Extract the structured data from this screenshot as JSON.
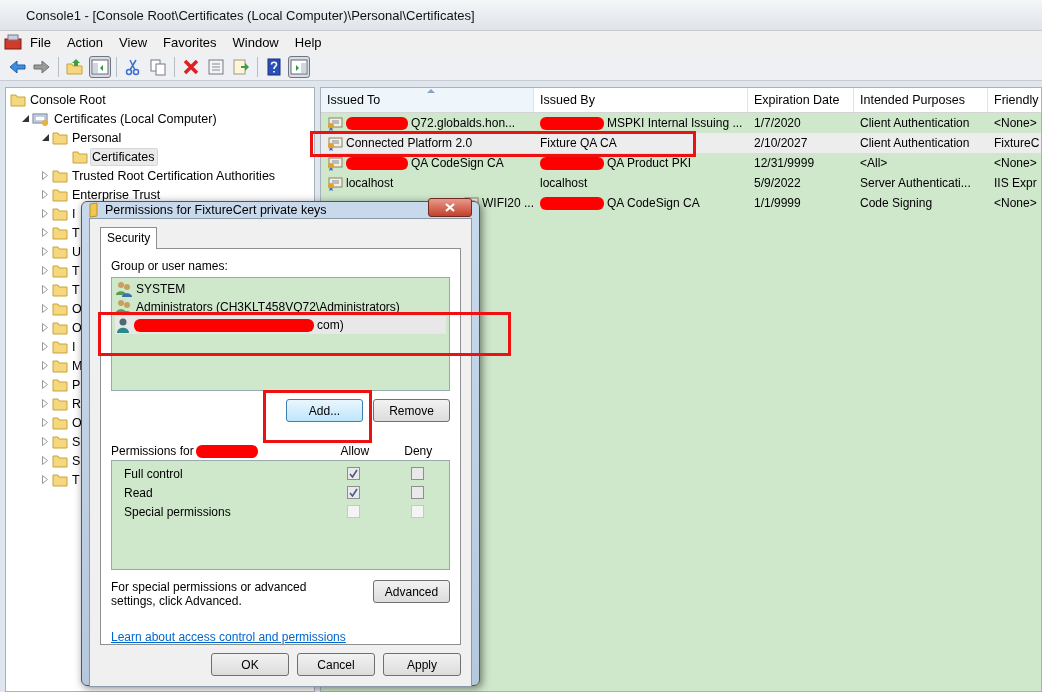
{
  "window": {
    "title": "Console1 - [Console Root\\Certificates (Local Computer)\\Personal\\Certificates]"
  },
  "menu": [
    "File",
    "Action",
    "View",
    "Favorites",
    "Window",
    "Help"
  ],
  "toolbar": [
    {
      "kind": "back",
      "pressed": false
    },
    {
      "kind": "forward",
      "pressed": false
    },
    {
      "kind": "separator"
    },
    {
      "kind": "up",
      "pressed": false
    },
    {
      "kind": "tree",
      "pressed": true
    },
    {
      "kind": "separator"
    },
    {
      "kind": "cut",
      "pressed": false
    },
    {
      "kind": "copy",
      "pressed": false
    },
    {
      "kind": "separator"
    },
    {
      "kind": "delete",
      "pressed": false
    },
    {
      "kind": "properties",
      "pressed": false
    },
    {
      "kind": "export",
      "pressed": false
    },
    {
      "kind": "separator"
    },
    {
      "kind": "help",
      "pressed": false
    },
    {
      "kind": "pane",
      "pressed": true
    }
  ],
  "tree": [
    {
      "label": "Console Root",
      "kind": "folder",
      "selected": false,
      "children": [
        {
          "label": "Certificates (Local Computer)",
          "kind": "store",
          "expanded": true,
          "selected": false,
          "children": [
            {
              "label": "Personal",
              "kind": "folder",
              "expanded": true,
              "selected": false,
              "children": [
                {
                  "label": "Certificates",
                  "kind": "folder",
                  "selected": true
                }
              ]
            },
            {
              "label": "Trusted Root Certification Authorities",
              "kind": "folder",
              "expanded": false,
              "selected": false
            },
            {
              "label": "Enterprise Trust",
              "kind": "folder",
              "expanded": false,
              "selected": false
            },
            {
              "label": "I",
              "kind": "folder",
              "expanded": false,
              "selected": false
            },
            {
              "label": "T",
              "kind": "folder",
              "expanded": false,
              "selected": false
            },
            {
              "label": "U",
              "kind": "folder",
              "expanded": false,
              "selected": false
            },
            {
              "label": "T",
              "kind": "folder",
              "expanded": false,
              "selected": false
            },
            {
              "label": "T",
              "kind": "folder",
              "expanded": false,
              "selected": false
            },
            {
              "label": "O",
              "kind": "folder",
              "expanded": false,
              "selected": false
            },
            {
              "label": "O",
              "kind": "folder",
              "expanded": false,
              "selected": false
            },
            {
              "label": "I",
              "kind": "folder",
              "expanded": false,
              "selected": false
            },
            {
              "label": "M",
              "kind": "folder",
              "expanded": false,
              "selected": false
            },
            {
              "label": "P",
              "kind": "folder",
              "expanded": false,
              "selected": false
            },
            {
              "label": "R",
              "kind": "folder",
              "expanded": false,
              "selected": false
            },
            {
              "label": "O",
              "kind": "folder",
              "expanded": false,
              "selected": false
            },
            {
              "label": "S",
              "kind": "folder",
              "expanded": false,
              "selected": false
            },
            {
              "label": "S",
              "kind": "folder",
              "expanded": false,
              "selected": false
            },
            {
              "label": "T",
              "kind": "folder",
              "expanded": false,
              "selected": false
            }
          ]
        }
      ]
    }
  ],
  "list": {
    "columns": [
      {
        "label": "Issued To",
        "sorted": true
      },
      {
        "label": "Issued By",
        "sorted": false
      },
      {
        "label": "Expiration Date",
        "sorted": false
      },
      {
        "label": "Intended Purposes",
        "sorted": false
      },
      {
        "label": "Friendly",
        "sorted": false
      }
    ],
    "rows": [
      {
        "selected": false,
        "cells": [
          {
            "text": "Q72.globalds.hon...",
            "redacted": true
          },
          {
            "text": "MSPKI Internal Issuing ...",
            "redacted": true
          },
          {
            "text": "1/7/2020",
            "redacted": false
          },
          {
            "text": "Client Authentication",
            "redacted": false
          },
          {
            "text": "<None>",
            "redacted": false
          }
        ]
      },
      {
        "selected": true,
        "cells": [
          {
            "text": "Connected Platform 2.0",
            "redacted": false
          },
          {
            "text": "Fixture QA CA",
            "redacted": false
          },
          {
            "text": "2/10/2027",
            "redacted": false
          },
          {
            "text": "Client Authentication",
            "redacted": false
          },
          {
            "text": "FixtureC",
            "redacted": false
          }
        ]
      },
      {
        "selected": false,
        "cells": [
          {
            "text": "QA CodeSign CA",
            "redacted": true
          },
          {
            "text": "QA Product PKI",
            "redacted": true
          },
          {
            "text": "12/31/9999",
            "redacted": false
          },
          {
            "text": "<All>",
            "redacted": false
          },
          {
            "text": "<None>",
            "redacted": false
          }
        ]
      },
      {
        "selected": false,
        "cells": [
          {
            "text": "localhost",
            "redacted": false
          },
          {
            "text": "localhost",
            "redacted": false
          },
          {
            "text": "5/9/2022",
            "redacted": false
          },
          {
            "text": "Server Authenticati...",
            "redacted": false
          },
          {
            "text": "IIS Expr",
            "redacted": false
          }
        ]
      },
      {
        "selected": false,
        "cells": [
          {
            "text": "WIFI20 ...",
            "redacted": false
          },
          {
            "text": "QA CodeSign CA",
            "redacted": true
          },
          {
            "text": "1/1/9999",
            "redacted": false
          },
          {
            "text": "Code Signing",
            "redacted": false
          },
          {
            "text": "<None>",
            "redacted": false
          }
        ]
      }
    ]
  },
  "dialog": {
    "title": "Permissions for FixtureCert private keys",
    "tabs": [
      {
        "label": "Security",
        "selected": true
      }
    ],
    "group_label": "Group or user names:",
    "users": [
      {
        "name": "SYSTEM",
        "kind": "group",
        "selected": false,
        "redacted": false
      },
      {
        "name": "Administrators (CH3KLT458VQ72\\Administrators)",
        "kind": "group",
        "selected": false,
        "redacted": false
      },
      {
        "name": "com)",
        "kind": "user",
        "selected": true,
        "redacted": true
      }
    ],
    "user_buttons": [
      "Add...",
      "Remove"
    ],
    "permissions_label": "Permissions for",
    "allow_label": "Allow",
    "deny_label": "Deny",
    "permissions": [
      {
        "name": "Full control",
        "allow": true,
        "deny": false,
        "disabled": false
      },
      {
        "name": "Read",
        "allow": true,
        "deny": false,
        "disabled": false
      },
      {
        "name": "Special permissions",
        "allow": false,
        "deny": false,
        "disabled": true
      }
    ],
    "advanced_text": "For special permissions or advanced settings, click Advanced.",
    "advanced_button": "Advanced",
    "link": "Learn about access control and permissions",
    "buttons": [
      "OK",
      "Cancel",
      "Apply"
    ]
  }
}
